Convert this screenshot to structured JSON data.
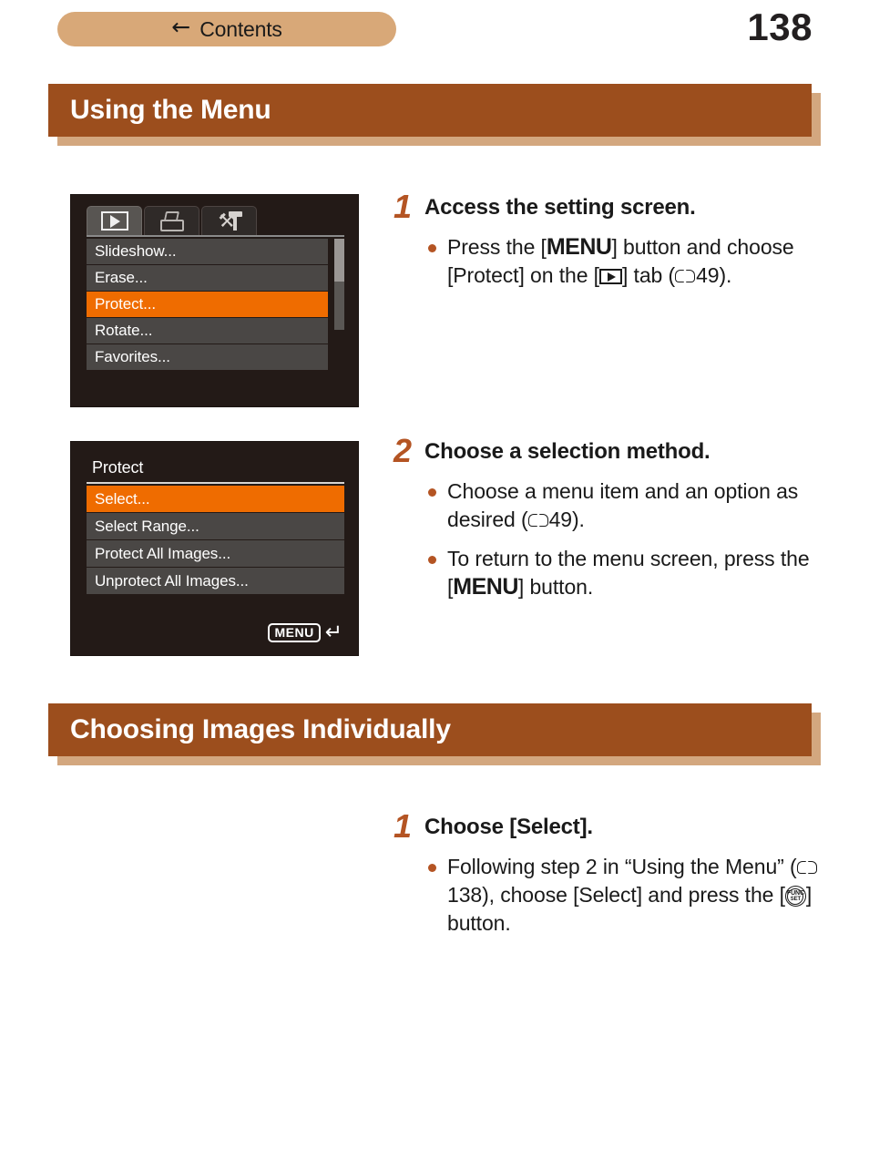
{
  "topbar": {
    "contents_label": "Contents",
    "back_arrow_glyph": "←",
    "page_number": "138"
  },
  "sections": [
    {
      "id": "using-the-menu",
      "title": "Using the Menu"
    },
    {
      "id": "choosing-images-individually",
      "title": "Choosing Images Individually"
    }
  ],
  "figures": {
    "menu_screen": {
      "tabs": [
        {
          "icon": "play-icon",
          "active": true
        },
        {
          "icon": "printer-icon",
          "active": false
        },
        {
          "icon": "tools-icon",
          "active": false
        }
      ],
      "items": [
        {
          "label": "Slideshow...",
          "selected": false
        },
        {
          "label": "Erase...",
          "selected": false
        },
        {
          "label": "Protect...",
          "selected": true
        },
        {
          "label": "Rotate...",
          "selected": false
        },
        {
          "label": "Favorites...",
          "selected": false
        }
      ]
    },
    "protect_screen": {
      "title": "Protect",
      "items": [
        {
          "label": "Select...",
          "selected": true
        },
        {
          "label": "Select Range...",
          "selected": false
        },
        {
          "label": "Protect All Images...",
          "selected": false
        },
        {
          "label": "Unprotect All Images...",
          "selected": false
        }
      ],
      "footer": {
        "menu_badge": "MENU",
        "return_arrow": "↵"
      }
    }
  },
  "steps": {
    "step1": {
      "number": "1",
      "title": "Access the setting screen.",
      "bullet1": {
        "part1": "Press the [",
        "menu": "MENU",
        "part2": "] button and choose [Protect] on the [",
        "part3": "] tab (",
        "page_ref": "49",
        "part4": ")."
      }
    },
    "step2": {
      "number": "2",
      "title": "Choose a selection method.",
      "bullet1": {
        "part1": "Choose a menu item and an option as desired (",
        "page_ref": "49",
        "part2": ")."
      },
      "bullet2": {
        "part1": "To return to the menu screen, press the [",
        "menu": "MENU",
        "part2": "] button."
      }
    },
    "step3": {
      "number": "1",
      "title": "Choose [Select].",
      "bullet1": {
        "part1": "Following step 2 in “Using the Menu” (",
        "page_ref": "138",
        "part2": "), choose [Select] and press the [",
        "func_line1": "FUNC",
        "func_line2": "SET",
        "part3": "] button."
      }
    }
  },
  "colors": {
    "header_brown": "#9c4e1d",
    "header_shadow_tan": "#d3a77f",
    "contents_tan": "#d8a878",
    "accent_orange": "#ef6c00",
    "step_number_brown": "#b45423",
    "screen_background": "#231a17",
    "menu_row_gray": "#4a4745"
  }
}
